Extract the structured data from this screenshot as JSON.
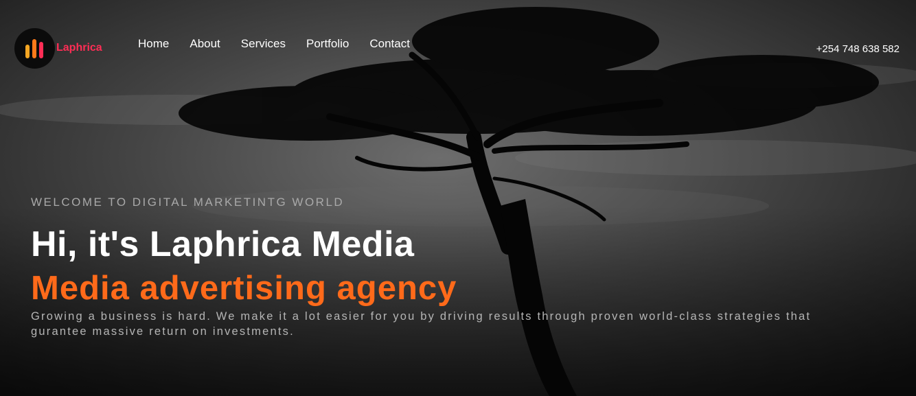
{
  "brand": {
    "name": "Laphrica",
    "colors": {
      "accent": "#ff2d55",
      "headline_orange": "#ff6a1a",
      "bar1": "#f5a623",
      "bar2": "#ff7a1a"
    }
  },
  "nav": {
    "items": [
      {
        "label": "Home"
      },
      {
        "label": "About"
      },
      {
        "label": "Services"
      },
      {
        "label": "Portfolio"
      },
      {
        "label": "Contact"
      }
    ]
  },
  "header": {
    "phone": "+254 748 638 582"
  },
  "hero": {
    "eyebrow": "WELCOME TO DIGITAL MARKETINTG WORLD",
    "title": "Hi, it's Laphrica Media",
    "subtitle": "Media advertising agency",
    "description": "Growing a business is hard. We make it a lot easier for you by driving results through proven world-class strategies that gurantee massive return on investments.",
    "background": "acacia-tree-silhouette"
  }
}
